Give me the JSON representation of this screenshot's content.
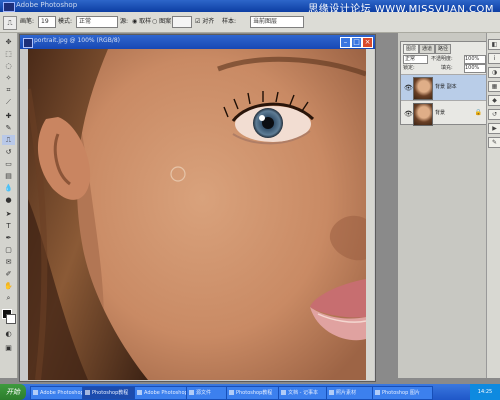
{
  "window": {
    "title": "Adobe Photoshop",
    "watermark": "思缘设计论坛 WWW.MISSVUAN.COM"
  },
  "options_bar": {
    "brush_label": "画笔:",
    "brush_size": "19",
    "mode_label": "模式:",
    "mode_value": "正常",
    "source_label": "源:",
    "source_sampled": "取样",
    "source_pattern": "图案",
    "aligned_label": "对齐",
    "sample_label": "样本:",
    "sample_value": "当前图层"
  },
  "document": {
    "title": "portrait.jpg @ 100% (RGB/8)"
  },
  "layers_panel": {
    "tabs": [
      "图层",
      "通道",
      "路径"
    ],
    "blend_mode": "正常",
    "opacity_label": "不透明度:",
    "opacity_value": "100%",
    "lock_label": "锁定:",
    "fill_label": "填充:",
    "fill_value": "100%",
    "layers": [
      {
        "name": "背景 副本",
        "selected": true
      },
      {
        "name": "背景",
        "locked": true
      }
    ]
  },
  "taskbar": {
    "start_label": "开始",
    "tasks": [
      "Adobe Photoshop",
      "Photoshop教程",
      "Adobe Photoshop",
      "源文件",
      "Photoshop教程",
      "文档 - 记事本",
      "照片素材",
      "Photoshop 图片"
    ],
    "clock": "14:25"
  },
  "icons": [
    "ps-icon",
    "eye-icon",
    "lock-icon",
    "brush-icon",
    "stamp-icon",
    "move-icon",
    "lasso-icon",
    "crop-icon",
    "zoom-icon",
    "hand-icon"
  ]
}
